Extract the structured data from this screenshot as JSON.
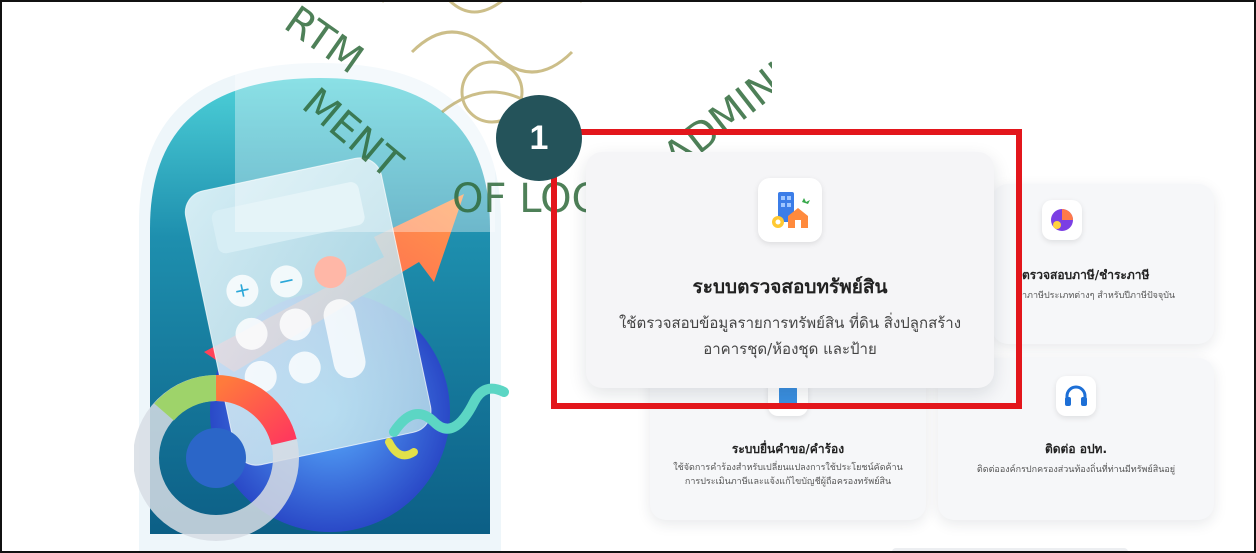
{
  "watermark": {
    "text_left": "MENT",
    "text_left2": "RTM",
    "text_mid": "OF LOCAL",
    "text_right": "ADMINISTR"
  },
  "step": {
    "number": "1"
  },
  "cards": {
    "asset": {
      "title": "ระบบตรวจสอบทรัพย์สิน",
      "desc_line1": "ใช้ตรวจสอบข้อมูลรายการทรัพย์สิน ที่ดิน สิ่งปลูกสร้าง",
      "desc_line2": "อาคารชุด/ห้องชุด และป้าย",
      "icon": "buildings-icon"
    },
    "tax": {
      "title": "ตรวจสอบภาษี/ชำระภาษี",
      "desc": "ำภาษีประเภทต่างๆ สำหรับปีภาษีปัจจุบัน",
      "icon": "tax-chart-icon"
    },
    "request": {
      "title": "ระบบยื่นคำขอ/คำร้อง",
      "desc_line1": "ใช้จัดการคำร้องสำหรับเปลี่ยนแปลงการใช้ประโยชน์คัดค้าน",
      "desc_line2": "การประเมินภาษีและแจ้งแก้ไขบัญชีผู้ถือครองทรัพย์สิน",
      "icon": "document-icon"
    },
    "contact": {
      "title": "ติดต่อ อปท.",
      "desc": "ติดต่อองค์กรปกครองส่วนท้องถิ่นที่ท่านมีทรัพย์สินอยู่",
      "icon": "headphones-icon"
    }
  },
  "colors": {
    "highlight": "#e3161c",
    "badge": "#24535a",
    "watermark_gold": "#a38a2a",
    "watermark_green": "#2f6a3a"
  }
}
